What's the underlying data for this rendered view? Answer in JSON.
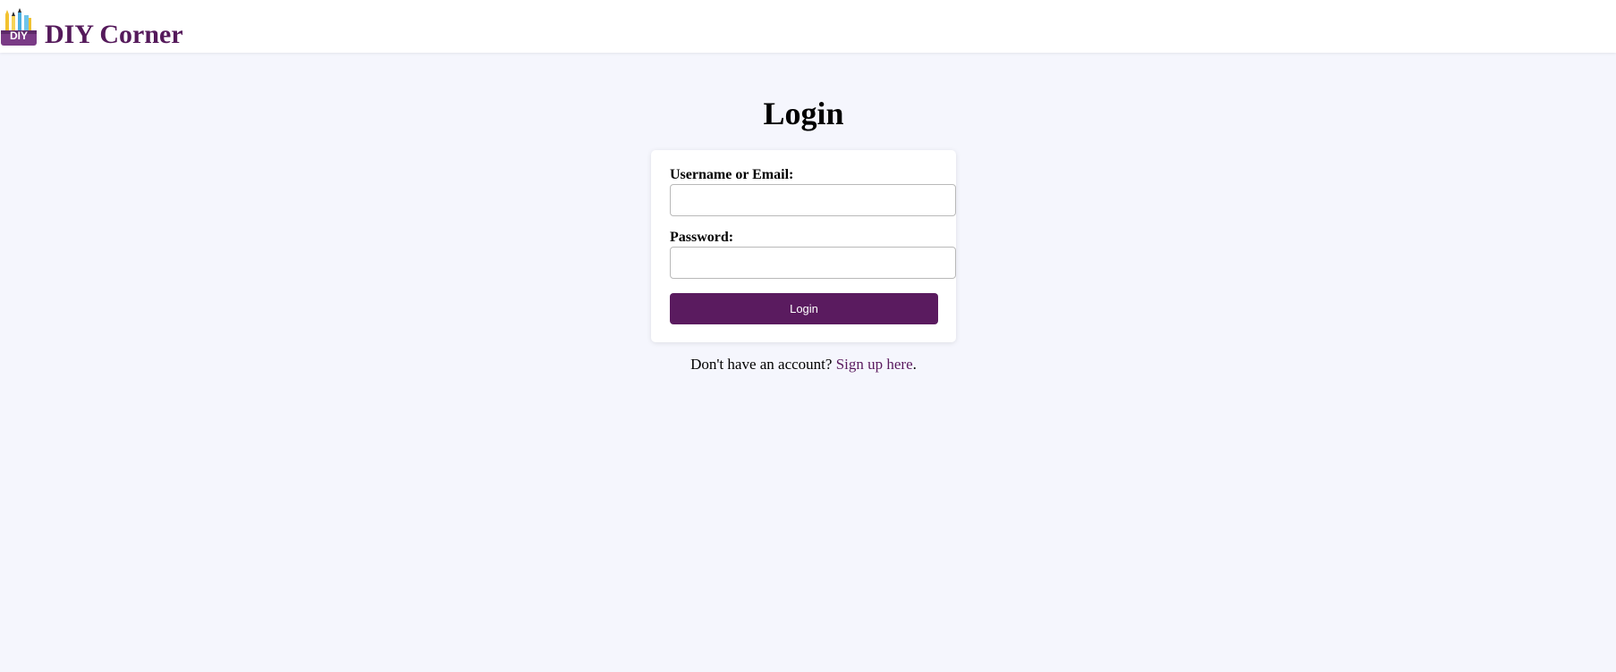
{
  "header": {
    "logo_text": "DIY",
    "brand": "DIY Corner"
  },
  "login": {
    "title": "Login",
    "username_label": "Username or Email:",
    "username_value": "",
    "password_label": "Password:",
    "password_value": "",
    "submit_label": "Login"
  },
  "signup": {
    "prompt": "Don't have an account? ",
    "link_text": "Sign up here",
    "suffix": "."
  },
  "colors": {
    "brand": "#551a5b",
    "button": "#5a1b5f",
    "page_background": "#f5f6fd"
  },
  "icons": {
    "logo": "diy-tools-logo-icon"
  }
}
